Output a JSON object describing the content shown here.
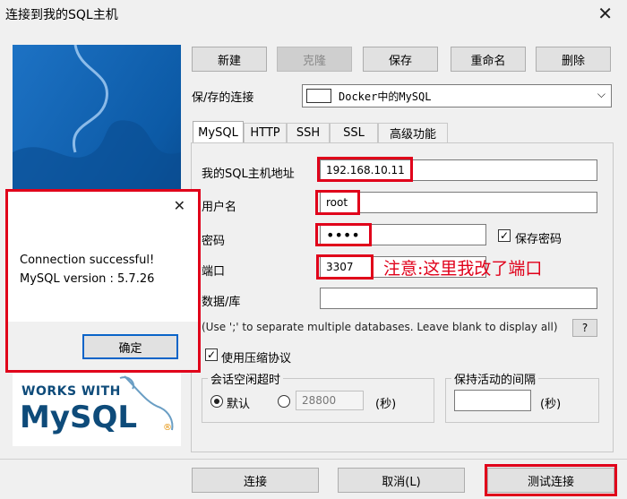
{
  "window": {
    "title": "连接到我的SQL主机"
  },
  "toolbar": {
    "new": "新建",
    "clone": "克隆",
    "save": "保存",
    "rename": "重命名",
    "delete": "删除"
  },
  "saved_connection": {
    "label": "保/存的连接",
    "value": "Docker中的MySQL"
  },
  "tabs": [
    "MySQL",
    "HTTP",
    "SSH",
    "SSL",
    "高级功能"
  ],
  "form": {
    "host_label": "我的SQL主机地址",
    "host_value": "192.168.10.11",
    "user_label": "用户名",
    "user_value": "root",
    "password_label": "密码",
    "password_value": "••••",
    "save_password_label": "保存密码",
    "port_label": "端口",
    "port_value": "3307",
    "database_label": "数据/库",
    "database_value": "",
    "hint": "(Use ';' to separate multiple databases. Leave blank to display all)",
    "help_button": "?",
    "compression_label": "使用压缩协议",
    "idle_group_title": "会话空闲超时",
    "idle_default_label": "默认",
    "idle_value": "28800",
    "idle_unit": "(秒)",
    "keepalive_group_title": "保持活动的间隔",
    "keepalive_value": "",
    "keepalive_unit": "(秒)"
  },
  "annotation": {
    "text": "注意:这里我改了端口"
  },
  "footer": {
    "connect": "连接",
    "cancel": "取消(L)",
    "test": "测试连接"
  },
  "popup": {
    "line1": "Connection successful!",
    "line2": "MySQL version : 5.7.26",
    "ok": "确定"
  },
  "sidebar": {
    "logo_works": "WORKS WITH",
    "logo_mysql": "MySQL",
    "logo_mark": "®"
  },
  "colors": {
    "highlight": "#e0001a",
    "mysql_blue": "#0e4b7a",
    "mysql_orange": "#e48e00",
    "puzzle_blue": "#0c5aa6"
  }
}
